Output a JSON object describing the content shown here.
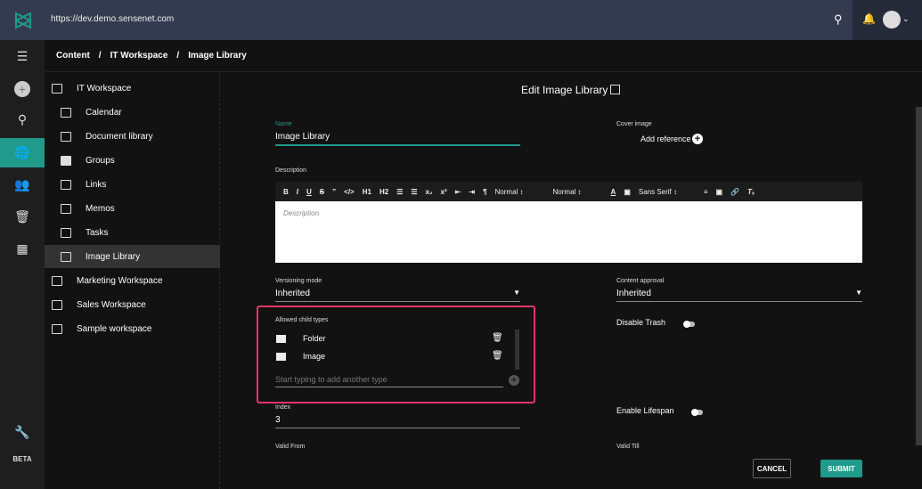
{
  "topbar": {
    "url": "https://dev.demo.sensenet.com"
  },
  "rail": {
    "beta": "BETA"
  },
  "breadcrumb": [
    "Content",
    "IT Workspace",
    "Image Library"
  ],
  "tree": [
    {
      "label": "IT Workspace",
      "icon": "workspace-icon"
    },
    {
      "label": "Calendar",
      "icon": "calendar-icon"
    },
    {
      "label": "Document library",
      "icon": "library-icon"
    },
    {
      "label": "Groups",
      "icon": "folder-icon"
    },
    {
      "label": "Links",
      "icon": "library-icon"
    },
    {
      "label": "Memos",
      "icon": "library-icon"
    },
    {
      "label": "Tasks",
      "icon": "library-icon"
    },
    {
      "label": "Image Library",
      "icon": "image-icon",
      "selected": true
    },
    {
      "label": "Marketing Workspace",
      "icon": "workspace-icon"
    },
    {
      "label": "Sales Workspace",
      "icon": "workspace-icon"
    },
    {
      "label": "Sample workspace",
      "icon": "workspace-icon"
    }
  ],
  "form": {
    "title": "Edit Image Library",
    "name_label": "Name",
    "name_value": "Image Library",
    "cover_label": "Cover image",
    "add_reference": "Add reference",
    "description_label": "Description",
    "description_placeholder": "Description",
    "toolbar": {
      "size1": "Normal",
      "size2": "Normal",
      "font": "Sans Serif"
    },
    "versioning_label": "Versioning mode",
    "versioning_value": "Inherited",
    "approval_label": "Content approval",
    "approval_value": "Inherited",
    "allowed_label": "Allowed child types",
    "allowed": [
      {
        "label": "Folder",
        "icon": "folder-icon"
      },
      {
        "label": "Image",
        "icon": "image-icon"
      }
    ],
    "allowed_placeholder": "Start typing to add another type",
    "disable_trash": "Disable Trash",
    "enable_lifespan": "Enable Lifespan",
    "index_label": "Index",
    "index_value": "3",
    "valid_from": "Valid From",
    "valid_till": "Valid Till",
    "cancel": "CANCEL",
    "submit": "SUBMIT"
  },
  "colors": {
    "accent": "#1f9a8b",
    "highlight": "#e8336b",
    "topbar": "#343b4f"
  }
}
